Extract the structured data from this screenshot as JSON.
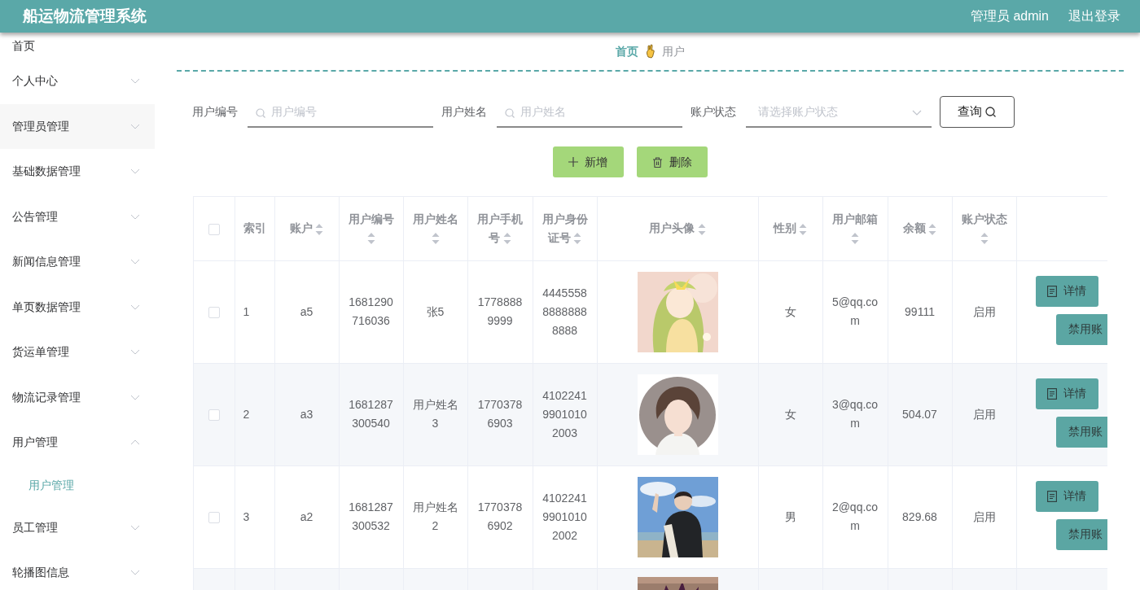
{
  "header": {
    "title": "船运物流管理系统",
    "user": "管理员 admin",
    "logout": "退出登录"
  },
  "sidebar": {
    "items": [
      {
        "kind": "link",
        "label": "首页"
      },
      {
        "kind": "menu",
        "label": "个人中心",
        "expanded": false
      },
      {
        "kind": "menu",
        "label": "管理员管理",
        "expanded": false,
        "hovered": true
      },
      {
        "kind": "menu",
        "label": "基础数据管理",
        "expanded": false
      },
      {
        "kind": "menu",
        "label": "公告管理",
        "expanded": false
      },
      {
        "kind": "menu",
        "label": "新闻信息管理",
        "expanded": false
      },
      {
        "kind": "menu",
        "label": "单页数据管理",
        "expanded": false
      },
      {
        "kind": "menu",
        "label": "货运单管理",
        "expanded": false
      },
      {
        "kind": "menu",
        "label": "物流记录管理",
        "expanded": false
      },
      {
        "kind": "menu",
        "label": "用户管理",
        "expanded": true,
        "children": [
          {
            "label": "用户管理",
            "selected": true
          }
        ]
      },
      {
        "kind": "menu",
        "label": "员工管理",
        "expanded": false
      },
      {
        "kind": "menu",
        "label": "轮播图信息",
        "expanded": false
      }
    ]
  },
  "breadcrumb": [
    "首页",
    "用户"
  ],
  "search": {
    "fields": [
      {
        "kind": "input",
        "label": "用户编号",
        "placeholder": "用户编号"
      },
      {
        "kind": "input",
        "label": "用户姓名",
        "placeholder": "用户姓名"
      },
      {
        "kind": "select",
        "label": "账户状态",
        "placeholder": "请选择账户状态"
      }
    ],
    "button": "查询"
  },
  "actions": [
    {
      "kind": "add",
      "label": "新增"
    },
    {
      "kind": "delete",
      "label": "删除"
    }
  ],
  "table": {
    "columns": [
      {
        "kind": "check",
        "checked": false
      },
      {
        "kind": "text",
        "label": "索引",
        "sortable": false
      },
      {
        "kind": "text",
        "label": "账户",
        "sortable": true
      },
      {
        "kind": "text",
        "label": "用户编号",
        "sortable": true
      },
      {
        "kind": "text",
        "label": "用户姓名",
        "sortable": true
      },
      {
        "kind": "text",
        "label": "用户手机号",
        "sortable": true
      },
      {
        "kind": "text",
        "label": "用户身份证号",
        "sortable": true
      },
      {
        "kind": "text",
        "label": "用户头像",
        "sortable": true
      },
      {
        "kind": "text",
        "label": "性别",
        "sortable": true
      },
      {
        "kind": "text",
        "label": "用户邮箱",
        "sortable": true
      },
      {
        "kind": "text",
        "label": "余额",
        "sortable": true
      },
      {
        "kind": "text",
        "label": "账户状态",
        "sortable": true
      },
      {
        "kind": "actions"
      }
    ],
    "rows": [
      {
        "kind": "full",
        "cells": [
          {
            "kind": "check",
            "checked": false
          },
          "1",
          "a5",
          "1681290716036",
          "张5",
          "17788889999",
          "444555888888888888",
          {
            "kind": "picture"
          },
          "女",
          "5@qq.com",
          "99111",
          "启用"
        ],
        "buttons": [
          "详情",
          "禁用账"
        ]
      },
      {
        "kind": "full",
        "cells": [
          {
            "kind": "check",
            "checked": false
          },
          "2",
          "a3",
          "1681287300540",
          "用户姓名3",
          "17703786903",
          "410224199010102003",
          {
            "kind": "picture"
          },
          "女",
          "3@qq.com",
          "504.07",
          "启用"
        ],
        "buttons": [
          "详情",
          "禁用账"
        ]
      },
      {
        "kind": "full",
        "cells": [
          {
            "kind": "check",
            "checked": false
          },
          "3",
          "a2",
          "1681287300532",
          "用户姓名2",
          "17703786902",
          "410224199010102002",
          {
            "kind": "picture"
          },
          "男",
          "2@qq.com",
          "829.68",
          "启用"
        ],
        "buttons": [
          "详情",
          "禁用账"
        ]
      },
      {
        "kind": "cut",
        "cells": [
          {
            "kind": "picture"
          }
        ]
      }
    ]
  }
}
